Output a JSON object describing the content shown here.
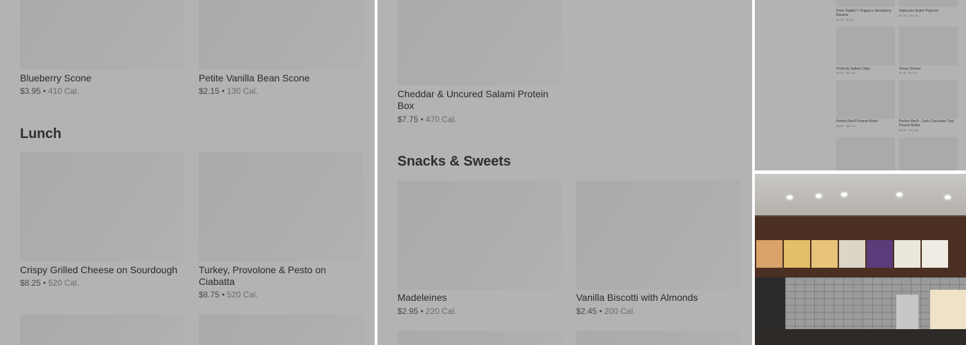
{
  "panel1": {
    "items_top": [
      {
        "name": "Blueberry Scone",
        "price": "$3.95",
        "cal": "410 Cal."
      },
      {
        "name": "Petite Vanilla Bean Scone",
        "price": "$2.15",
        "cal": "130 Cal."
      }
    ],
    "section_title": "Lunch",
    "items_lunch": [
      {
        "name": "Crispy Grilled Cheese on Sourdough",
        "price": "$8.25",
        "cal": "520 Cal."
      },
      {
        "name": "Turkey, Provolone & Pesto on Ciabatta",
        "price": "$8.75",
        "cal": "520 Cal."
      }
    ]
  },
  "panel2": {
    "item_top": {
      "name": "Cheddar & Uncured Salami Protein Box",
      "price": "$7.75",
      "cal": "470 Cal."
    },
    "section_title": "Snacks & Sweets",
    "items": [
      {
        "name": "Madeleines",
        "price": "$2.95",
        "cal": "220 Cal."
      },
      {
        "name": "Vanilla Biscotti with Almonds",
        "price": "$2.45",
        "cal": "200 Cal."
      }
    ]
  },
  "panel3": {
    "items": [
      {
        "name": "Peter Rabbit™ Organics Strawberry Banana",
        "meta": "$1.75 · 60 Cal."
      },
      {
        "name": "Starbucks Butter Popcorn",
        "meta": "$1.75 · 130 Cal."
      },
      {
        "name": "Perfectly Salted Chips",
        "meta": "$2.25 · 180 Cal."
      },
      {
        "name": "String Cheese",
        "meta": "$2.45 · 80 Cal."
      },
      {
        "name": "Perfect Bar® Peanut Butter",
        "meta": "$3.25 · 330 Cal."
      },
      {
        "name": "Perfect Bar® - Dark Chocolate Chip Peanut Butter",
        "meta": "$3.25 · 320 Cal."
      }
    ]
  },
  "colors": {
    "panel_bg": "#b3b3b3",
    "placeholder": "#aaaaaa",
    "wood": "#4a2f22"
  }
}
